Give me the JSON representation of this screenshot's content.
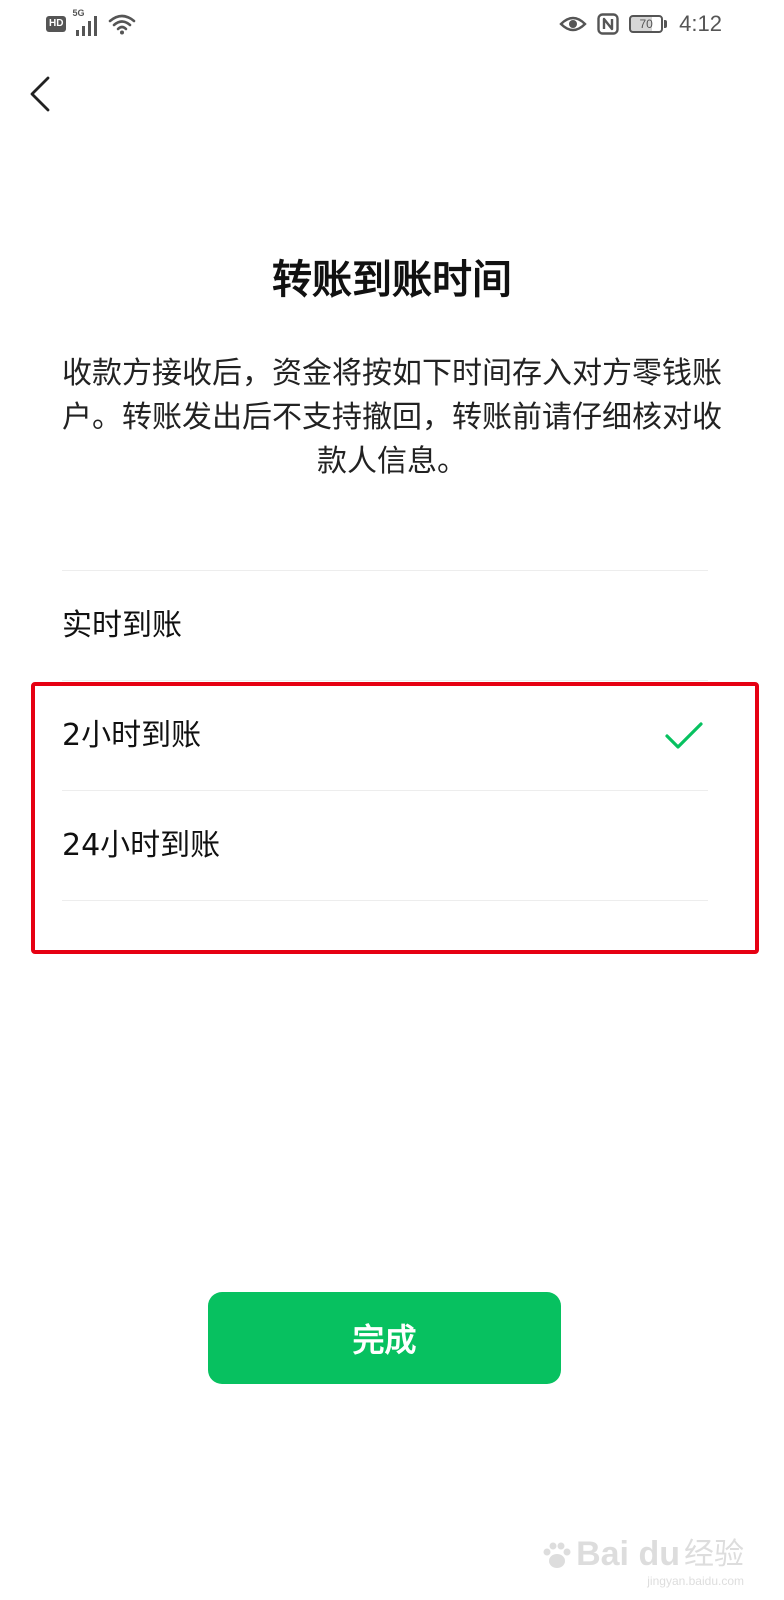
{
  "status_bar": {
    "hd_label": "HD",
    "network_label": "5G",
    "battery_level": "70",
    "time": "4:12",
    "icons": [
      "hd-badge",
      "signal-icon",
      "wifi-icon",
      "eye-icon",
      "nfc-icon",
      "battery-icon"
    ]
  },
  "nav": {
    "back_icon": "chevron-left-icon"
  },
  "page": {
    "title": "转账到账时间",
    "description": "收款方接收后，资金将按如下时间存入对方零钱账户。转账发出后不支持撤回，转账前请仔细核对收款人信息。"
  },
  "options": [
    {
      "label": "实时到账",
      "selected": false
    },
    {
      "label": "2小时到账",
      "selected": true
    },
    {
      "label": "24小时到账",
      "selected": false
    }
  ],
  "done_label": "完成",
  "watermark": {
    "brand": "Bai du",
    "suffix": "经验",
    "domain": "jingyan.baidu.com"
  },
  "colors": {
    "accent_green": "#07c160",
    "highlight_red": "#e60012",
    "divider": "#ededed"
  }
}
